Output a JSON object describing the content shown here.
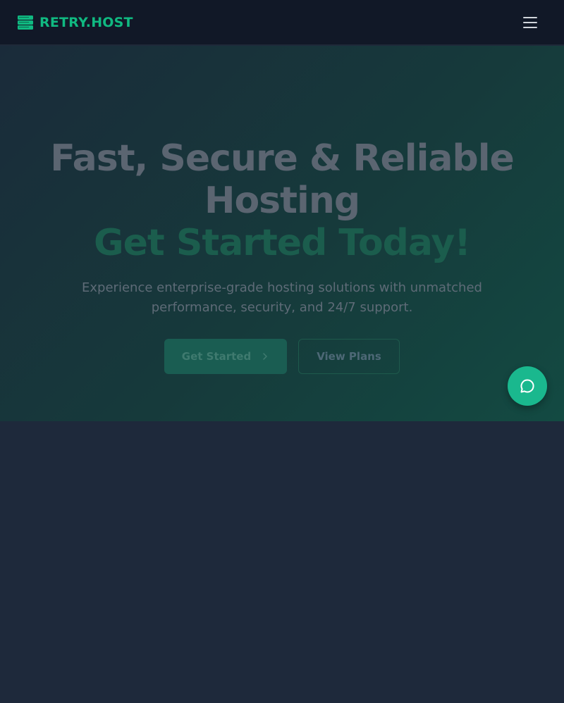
{
  "navbar": {
    "brand_name": "RETRY.HOST",
    "brand_icon": "server-stack-icon",
    "menu_icon": "hamburger-menu-icon"
  },
  "hero": {
    "title_line1": "Fast, Secure & Reliable",
    "title_line2": "Hosting",
    "title_accent": "Get Started Today!",
    "subtitle_line1": "Experience enterprise-grade hosting solutions with unmatched",
    "subtitle_line2": "performance, security, and 24/7 support.",
    "primary_button": "Get Started",
    "secondary_button": "View Plans"
  },
  "chat": {
    "icon": "chat-bubble-icon"
  },
  "colors": {
    "brand_accent": "#10b981",
    "navbar_bg": "#111827",
    "page_bg": "#1e293b",
    "chat_button": "#1ab88e"
  }
}
